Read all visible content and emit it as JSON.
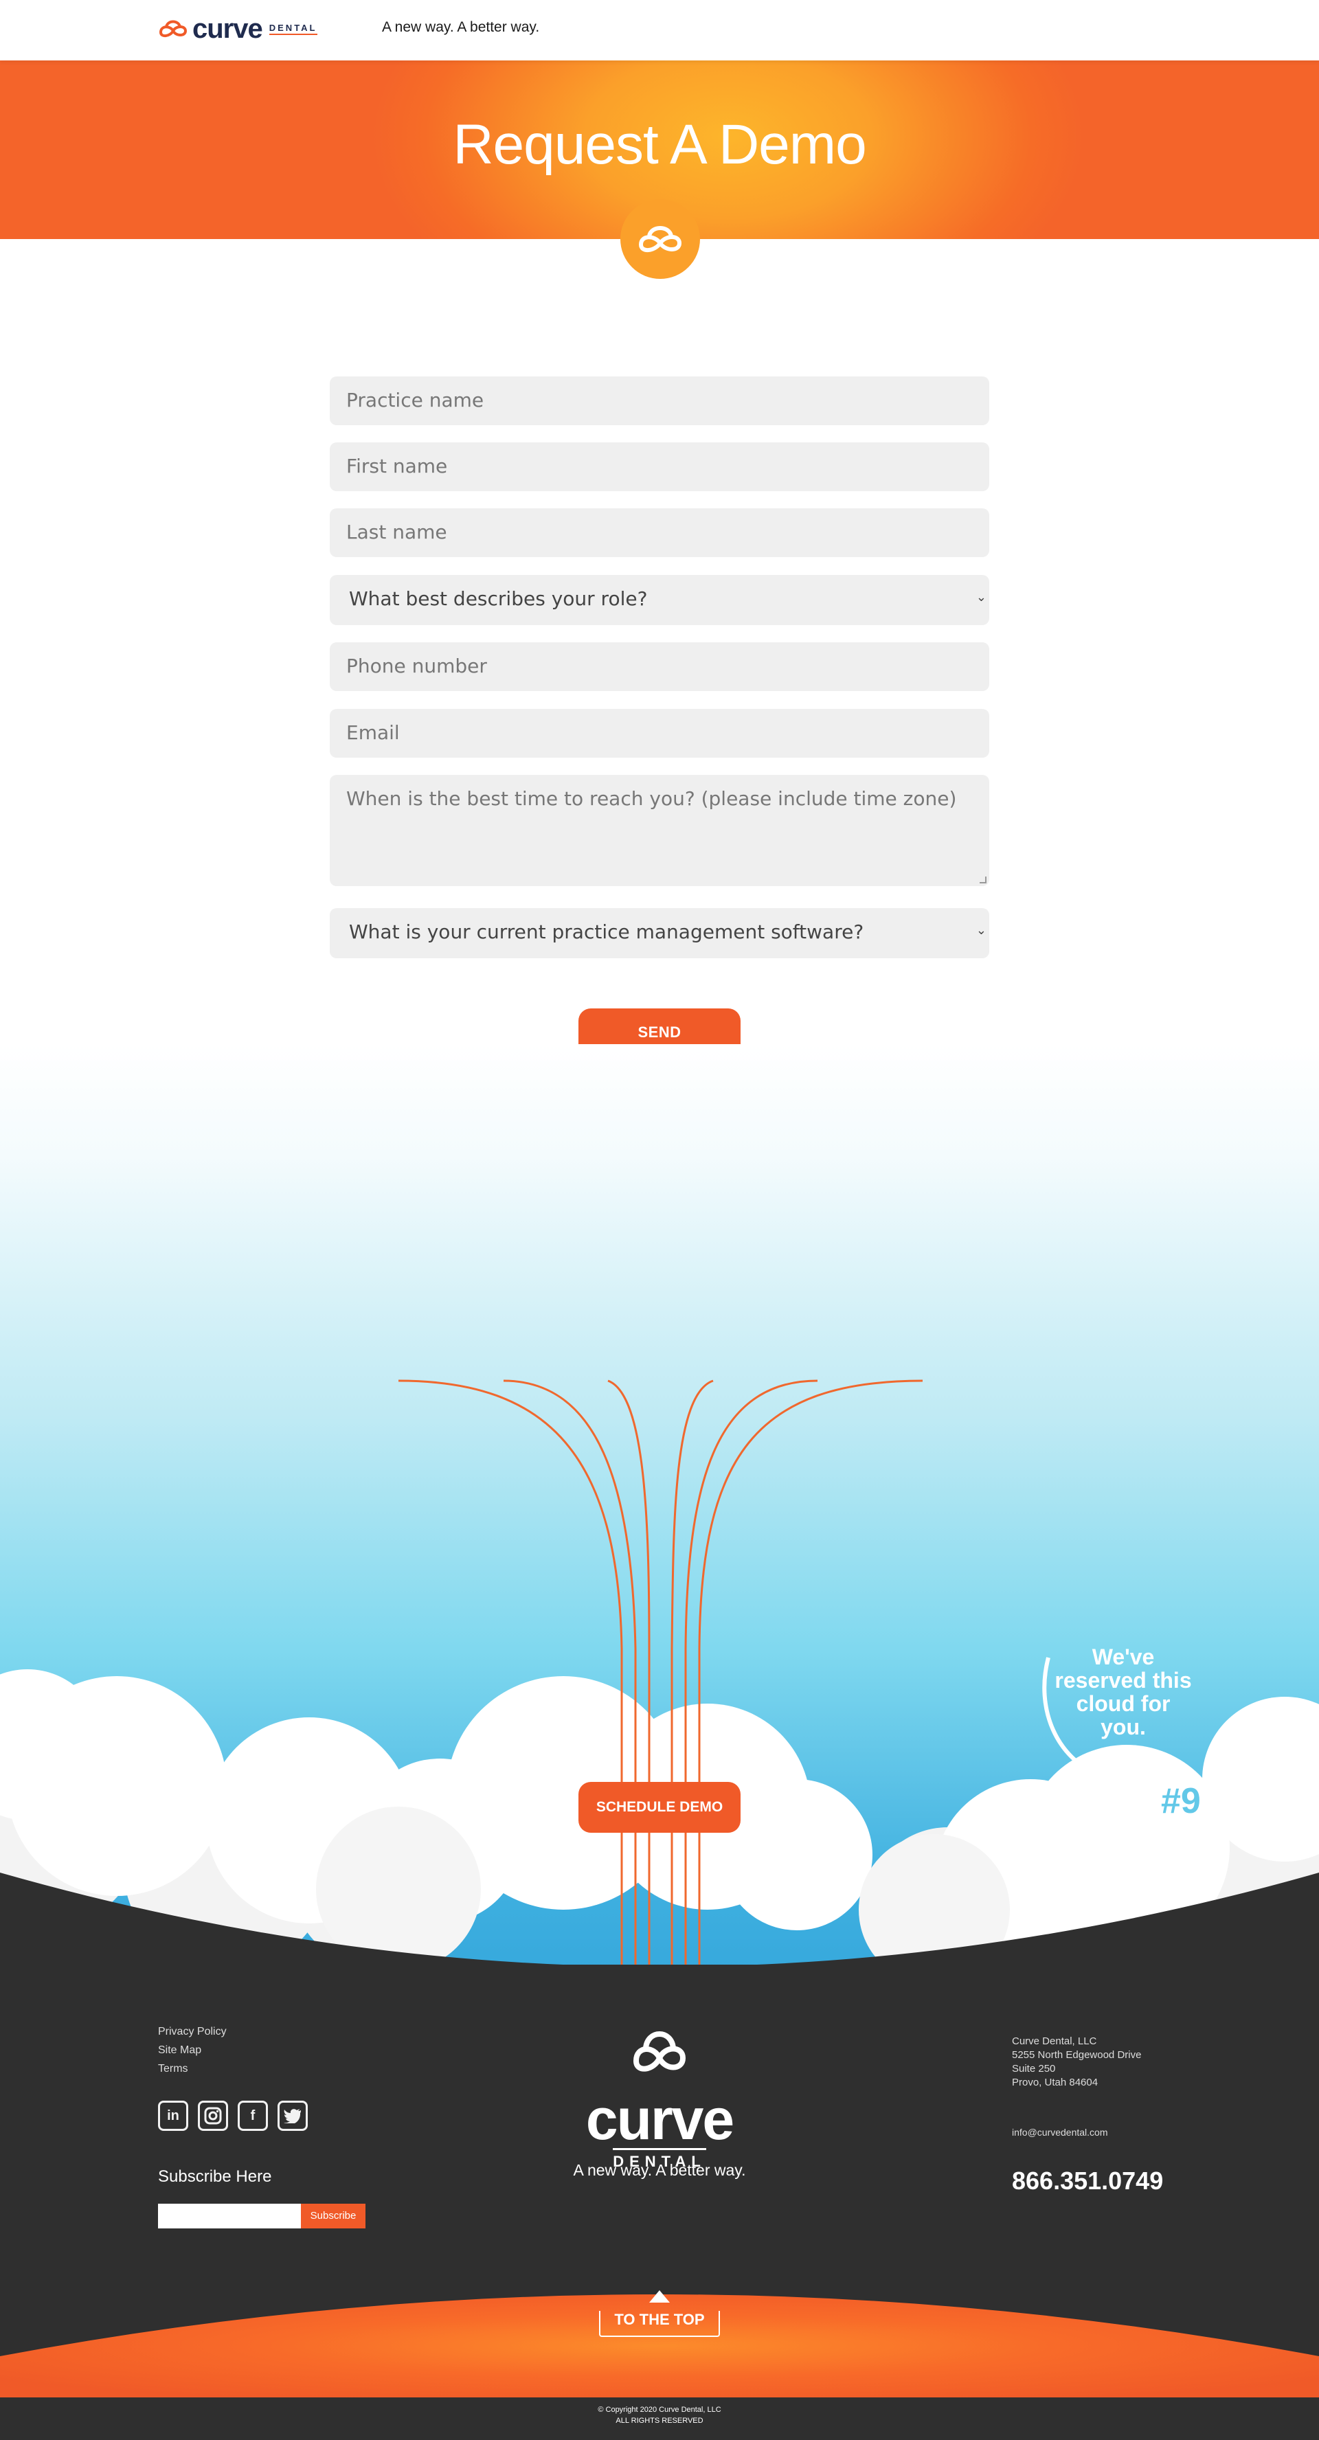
{
  "header": {
    "logo_word": "curve",
    "logo_sub": "DENTAL",
    "tagline": "A new way. A better way."
  },
  "hero": {
    "title": "Request A Demo",
    "badge_icon": "cloud-infinity-icon"
  },
  "form": {
    "practice_name": "Practice name",
    "first_name": "First name",
    "last_name": "Last name",
    "role": "What best describes your role?",
    "phone": "Phone number",
    "email": "Email",
    "best_time": "When is the best time to reach you? (please include time zone)",
    "software": "What is your current practice management software?",
    "send": "SEND"
  },
  "sky": {
    "schedule": "SCHEDULE DEMO",
    "note": "We've reserved this cloud for you.",
    "number": "#9"
  },
  "footer": {
    "links": [
      "Privacy Policy",
      "Site Map",
      "Terms"
    ],
    "social": [
      "linkedin-icon",
      "instagram-icon",
      "facebook-icon",
      "twitter-icon"
    ],
    "subscribe_title": "Subscribe Here",
    "subscribe_button": "Subscribe",
    "logo_word": "curve",
    "logo_sub": "DENTAL",
    "tagline": "A new way. A better way.",
    "address": [
      "Curve Dental, LLC",
      "5255 North Edgewood Drive",
      "Suite 250",
      "Provo, Utah 84604"
    ],
    "email": "info@curvedental.com",
    "phone": "866.351.0749",
    "to_top": "TO THE TOP",
    "copyright_1": "© Copyright 2020 Curve Dental, LLC",
    "copyright_2": "ALL RIGHTS RESERVED"
  },
  "colors": {
    "accent": "#f05a28",
    "hero_light": "#fdb52b",
    "sky": "#4bbde6",
    "footer": "#2f2f2f"
  }
}
